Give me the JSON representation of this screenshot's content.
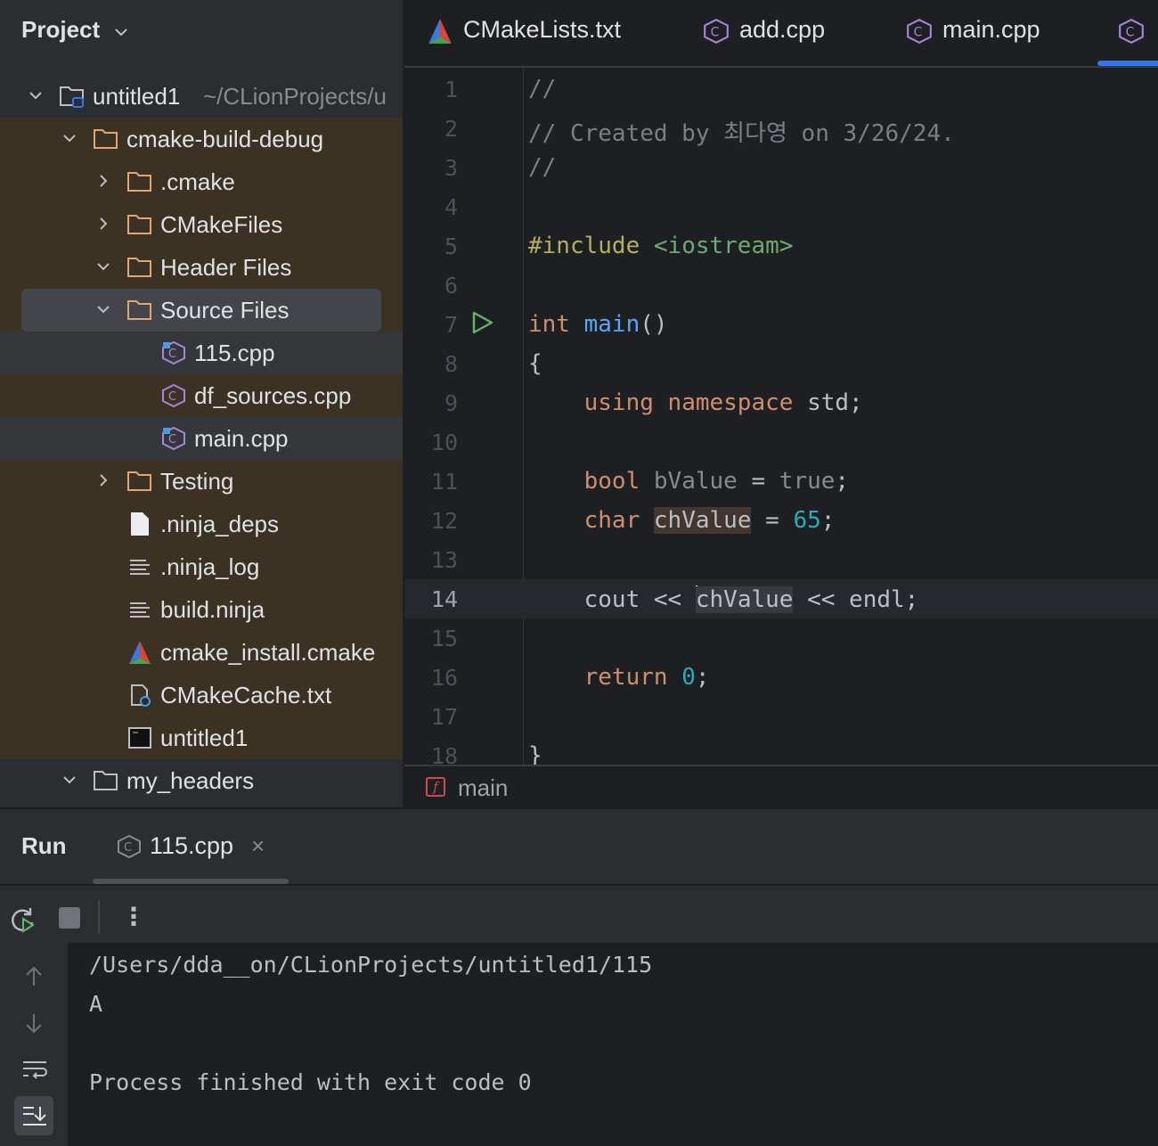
{
  "project_panel": {
    "title": "Project",
    "root": {
      "name": "untitled1",
      "path": "~/CLionProjects/u"
    },
    "tree": [
      {
        "name": "cmake-build-debug",
        "icon": "folder-icon"
      },
      {
        "name": ".cmake",
        "icon": "folder-icon"
      },
      {
        "name": "CMakeFiles",
        "icon": "folder-icon"
      },
      {
        "name": "Header Files",
        "icon": "folder-icon"
      },
      {
        "name": "Source Files",
        "icon": "folder-icon"
      },
      {
        "name": "115.cpp",
        "icon": "cpp-file-icon"
      },
      {
        "name": "df_sources.cpp",
        "icon": "cpp-file-icon"
      },
      {
        "name": "main.cpp",
        "icon": "cpp-file-icon"
      },
      {
        "name": "Testing",
        "icon": "folder-icon"
      },
      {
        "name": ".ninja_deps",
        "icon": "file-icon"
      },
      {
        "name": ".ninja_log",
        "icon": "text-file-icon"
      },
      {
        "name": "build.ninja",
        "icon": "text-file-icon"
      },
      {
        "name": "cmake_install.cmake",
        "icon": "cmake-icon"
      },
      {
        "name": "CMakeCache.txt",
        "icon": "cmake-cache-icon"
      },
      {
        "name": "untitled1",
        "icon": "executable-icon"
      },
      {
        "name": "my_headers",
        "icon": "folder-icon"
      }
    ]
  },
  "editor_tabs": [
    {
      "label": "CMakeLists.txt",
      "icon": "cmake-icon"
    },
    {
      "label": "add.cpp",
      "icon": "cpp-file-icon"
    },
    {
      "label": "main.cpp",
      "icon": "cpp-file-icon"
    },
    {
      "label": "",
      "icon": "cpp-file-icon",
      "active": true
    }
  ],
  "editor": {
    "current_line": 14,
    "lines": [
      {
        "n": "1",
        "t": {
          "a": "//"
        }
      },
      {
        "n": "2",
        "t": {
          "a": "// Created by 최다영 on 3/26/24."
        }
      },
      {
        "n": "3",
        "t": {
          "a": "//"
        }
      },
      {
        "n": "4",
        "t": {}
      },
      {
        "n": "5",
        "t": {
          "a": "#include",
          "b": " <iostream>"
        }
      },
      {
        "n": "6",
        "t": {}
      },
      {
        "n": "7",
        "t": {
          "a": "int",
          "b": " ",
          "c": "main",
          "d": "()"
        }
      },
      {
        "n": "8",
        "t": {
          "a": "{"
        }
      },
      {
        "n": "9",
        "t": {
          "a": "    ",
          "b": "using namespace",
          "c": " std;"
        }
      },
      {
        "n": "10",
        "t": {}
      },
      {
        "n": "11",
        "t": {
          "a": "    ",
          "b": "bool",
          "c": " bValue",
          "d": " = ",
          "e": "true",
          "f": ";"
        }
      },
      {
        "n": "12",
        "t": {
          "a": "    ",
          "b": "char",
          "c": " ",
          "d": "chValue",
          "e": " = ",
          "f": "65",
          "g": ";"
        }
      },
      {
        "n": "13",
        "t": {}
      },
      {
        "n": "14",
        "t": {
          "a": "    cout ",
          "b": "<<",
          "c": " ",
          "d": "chValue",
          "e": " ",
          "f": "<<",
          "g": " endl;"
        }
      },
      {
        "n": "15",
        "t": {}
      },
      {
        "n": "16",
        "t": {
          "a": "    ",
          "b": "return",
          "c": " ",
          "d": "0",
          "e": ";"
        }
      },
      {
        "n": "17",
        "t": {}
      },
      {
        "n": "18",
        "t": {
          "a": "}"
        }
      }
    ]
  },
  "breadcrumb": {
    "label": "main",
    "icon": "function-icon"
  },
  "run_panel": {
    "title": "Run",
    "tab_label": "115.cpp",
    "close_glyph": "×",
    "more_glyph": "⋮",
    "console": [
      "/Users/dda__on/CLionProjects/untitled1/115",
      "A",
      "",
      "Process finished with exit code 0"
    ]
  },
  "colors": {
    "accent": "#3574f0",
    "excluded_bg": "#3c3223",
    "folder": "#e0a774",
    "keyword": "#cf8e6d",
    "function": "#56a8f5",
    "string": "#6aab73",
    "number": "#2aacb8",
    "run_green": "#5fb865"
  }
}
